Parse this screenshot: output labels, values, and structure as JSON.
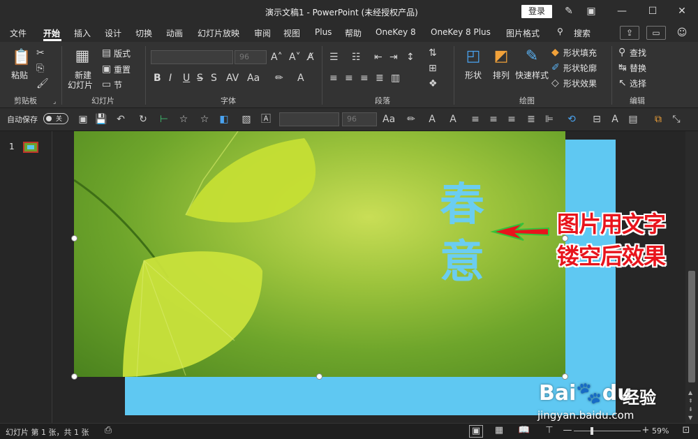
{
  "window": {
    "title": "演示文稿1 - PowerPoint (未经授权产品)",
    "login_label": "登录"
  },
  "menu": {
    "items": [
      "文件",
      "开始",
      "插入",
      "设计",
      "切换",
      "动画",
      "幻灯片放映",
      "审阅",
      "视图",
      "Plus",
      "帮助",
      "OneKey 8",
      "OneKey 8 Plus",
      "图片格式"
    ],
    "search_label": "搜索",
    "active_index": 1
  },
  "ribbon": {
    "clipboard": {
      "paste": "粘贴",
      "label": "剪贴板"
    },
    "slides": {
      "new_slide_line1": "新建",
      "new_slide_line2": "幻灯片",
      "layout": "版式",
      "reset": "重置",
      "section": "节",
      "label": "幻灯片"
    },
    "font": {
      "size": "96",
      "label": "字体"
    },
    "paragraph": {
      "label": "段落"
    },
    "drawing": {
      "shapes": "形状",
      "arrange": "排列",
      "quick_styles": "快速样式",
      "fill": "形状填充",
      "outline": "形状轮廓",
      "effects": "形状效果",
      "label": "绘图"
    },
    "editing": {
      "find": "查找",
      "replace": "替换",
      "select": "选择",
      "label": "编辑"
    }
  },
  "qat": {
    "autosave_label": "自动保存",
    "autosave_state": "关",
    "font_size": "96"
  },
  "slides_pane": {
    "number": "1"
  },
  "slide": {
    "chars": [
      "春",
      "意"
    ],
    "colors": {
      "hollow_text": "#6bcdf0",
      "backdrop": "#5fc8f2",
      "annotation": "#e8141c"
    }
  },
  "annotation": {
    "line1": "图片用文字",
    "line2": "镂空后效果"
  },
  "watermark": {
    "brand": "Bai",
    "brand2": "du",
    "cn": "经验",
    "url": "jingyan.baidu.com"
  },
  "status": {
    "slide_info": "幻灯片 第 1 张，共 1 张",
    "zoom": "59%"
  }
}
